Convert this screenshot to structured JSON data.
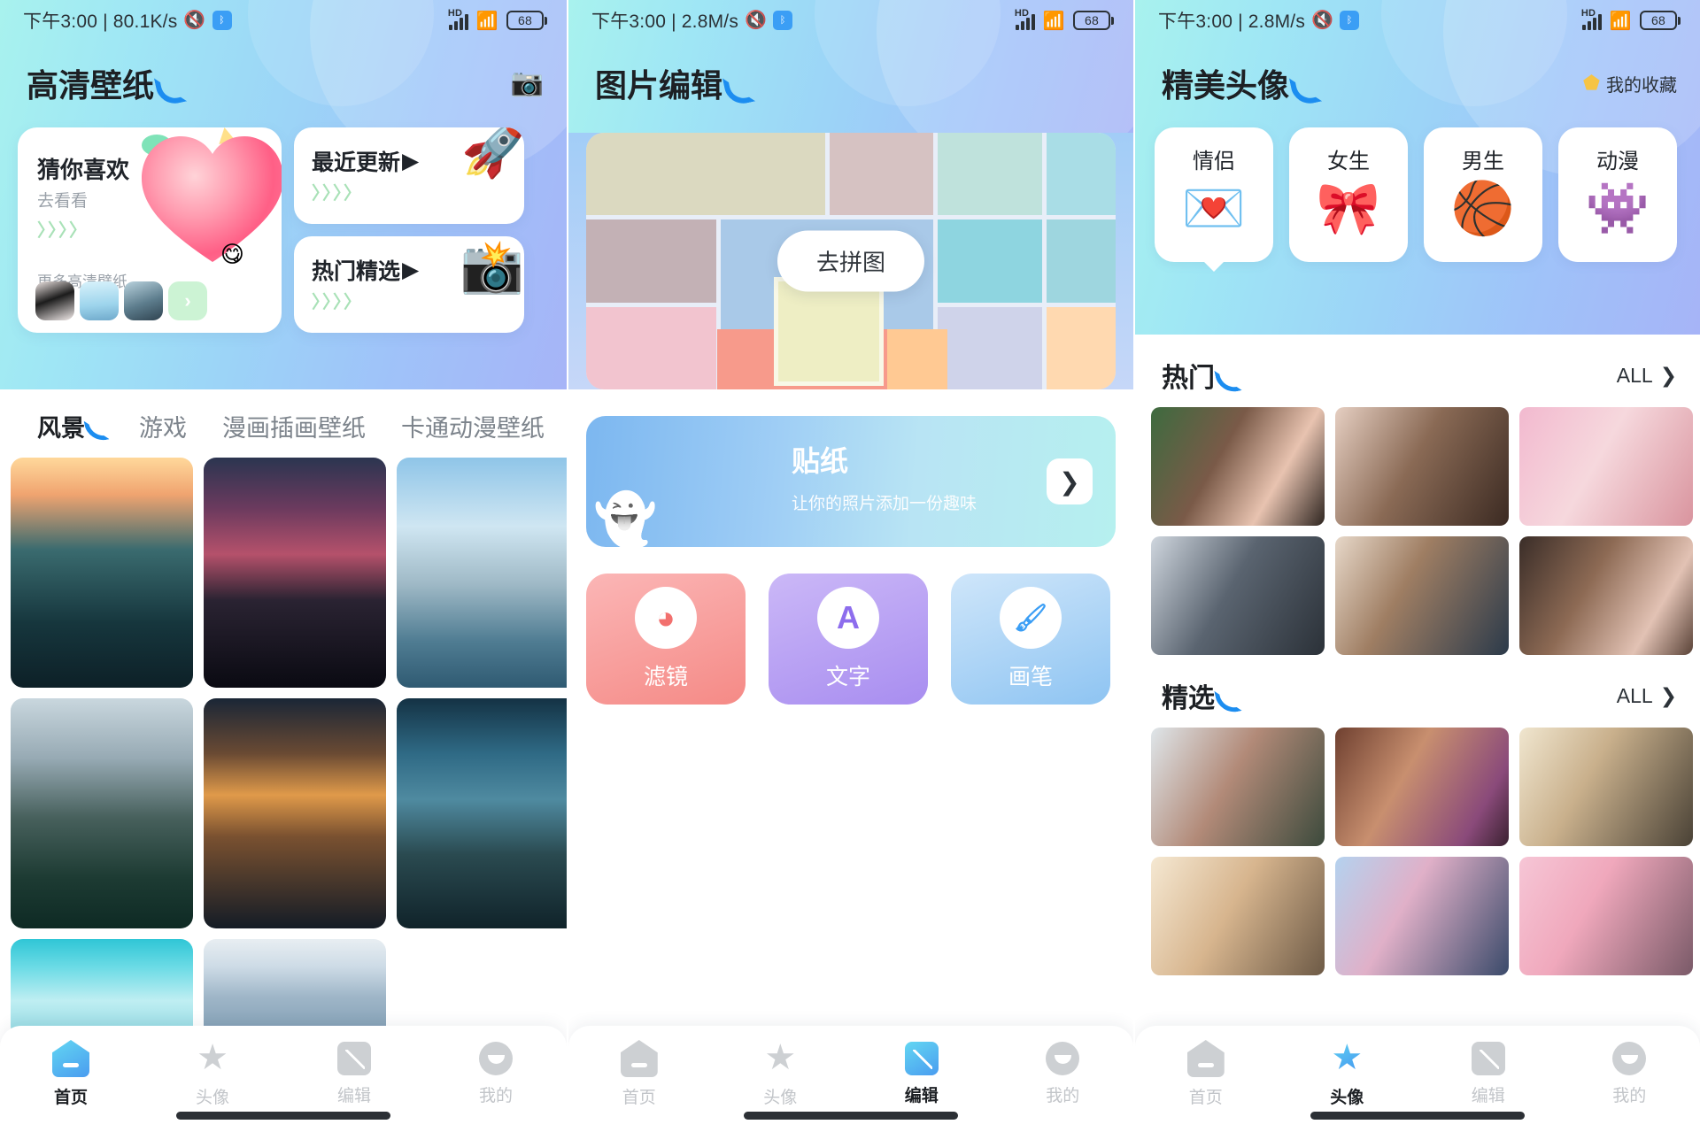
{
  "status_bar": {
    "time_1": "下午3:00 | 80.1K/s",
    "time_2": "下午3:00 | 2.8M/s",
    "time_3": "下午3:00 | 2.8M/s",
    "mute_icon": "mute-bell-icon",
    "bluetooth_icon": "bluetooth-icon",
    "hd_label": "HD",
    "signal_icon": "signal-bars-icon",
    "wifi_icon": "wifi-icon",
    "battery": "68"
  },
  "colors": {
    "accent_blue": "#1c8df0",
    "accent_cyan": "#63d7f2",
    "chevron_green": "#8dd8a0",
    "text_primary": "#1d2024",
    "text_muted": "#9aa1a9",
    "nav_inactive": "#c2c5c9",
    "star_yellow": "#f6c445"
  },
  "screen1": {
    "title": "高清壁纸",
    "camera_icon": "camera-icon",
    "card_main": {
      "title": "猜你喜欢",
      "subtitle": "去看看",
      "chevrons": "〉〉〉〉",
      "more_label": "更多高清壁纸",
      "thumb_count": 3,
      "arrow": "›"
    },
    "card_recent": {
      "title": "最近更新",
      "play": "▶",
      "chevrons": "〉〉〉〉",
      "art_icon": "rocket-icon"
    },
    "card_hot": {
      "title": "热门精选",
      "play": "▶",
      "chevrons": "〉〉〉〉",
      "art_icon": "camera-retro-icon"
    },
    "tabs": [
      {
        "label": "风景",
        "active": true
      },
      {
        "label": "游戏",
        "active": false
      },
      {
        "label": "漫画插画壁纸",
        "active": false
      },
      {
        "label": "卡通动漫壁纸",
        "active": false
      }
    ],
    "wallpapers": [
      "lake-sunrise-boat",
      "red-clouds-reflection",
      "diver-snow-mountain",
      "grey-pine-mountain",
      "golden-sunset-lake",
      "cabin-mountain-reflection",
      "turquoise-sky-clouds",
      "calm-sea-surface"
    ],
    "nav": [
      {
        "label": "首页",
        "icon": "home-icon",
        "active": true
      },
      {
        "label": "头像",
        "icon": "star-icon",
        "active": false
      },
      {
        "label": "编辑",
        "icon": "edit-icon",
        "active": false
      },
      {
        "label": "我的",
        "icon": "user-icon",
        "active": false
      }
    ]
  },
  "screen2": {
    "title": "图片编辑",
    "collage_button": "去拼图",
    "sticker": {
      "title": "贴纸",
      "subtitle": "让你的照片添加一份趣味",
      "next": "❯",
      "art_icon": "ghost-stickers-icon"
    },
    "tools": [
      {
        "label": "滤镜",
        "icon": "color-filter-icon",
        "glyph": "◕"
      },
      {
        "label": "文字",
        "icon": "text-letter-icon",
        "glyph": "A"
      },
      {
        "label": "画笔",
        "icon": "paintbrush-icon",
        "glyph": "🖌"
      }
    ],
    "nav": [
      {
        "label": "首页",
        "icon": "home-icon",
        "active": false
      },
      {
        "label": "头像",
        "icon": "star-icon",
        "active": false
      },
      {
        "label": "编辑",
        "icon": "edit-icon",
        "active": true
      },
      {
        "label": "我的",
        "icon": "user-icon",
        "active": false
      }
    ]
  },
  "screen3": {
    "title": "精美头像",
    "favorites_label": "我的收藏",
    "favorites_icon": "star-badge-icon",
    "chips": [
      {
        "label": "情侣",
        "icon": "heart-card-icon",
        "glyph": "💌",
        "selected": true
      },
      {
        "label": "女生",
        "icon": "pink-bow-icon",
        "glyph": "🎀",
        "selected": false
      },
      {
        "label": "男生",
        "icon": "basketball-icon",
        "glyph": "🏀",
        "selected": false
      },
      {
        "label": "动漫",
        "icon": "stitch-anime-icon",
        "glyph": "👾",
        "selected": false
      }
    ],
    "sections": [
      {
        "title": "热门",
        "all_label": "ALL",
        "all_arrow": "❯",
        "items": [
          "couple-green-hoodie",
          "couple-brown-hair",
          "couple-pink-hair",
          "boy-white-hair",
          "girl-ponytail-uniform",
          "couple-suit-anime"
        ]
      },
      {
        "title": "精选",
        "all_label": "ALL",
        "all_arrow": "❯",
        "items": [
          "couple-lying-down",
          "girl-green-jacket",
          "boy-white-shirt",
          "blonde-couple",
          "girl-blue-uniform",
          "couple-kiss-pink"
        ]
      }
    ],
    "nav": [
      {
        "label": "首页",
        "icon": "home-icon",
        "active": false
      },
      {
        "label": "头像",
        "icon": "star-icon",
        "active": true
      },
      {
        "label": "编辑",
        "icon": "edit-icon",
        "active": false
      },
      {
        "label": "我的",
        "icon": "user-icon",
        "active": false
      }
    ]
  }
}
